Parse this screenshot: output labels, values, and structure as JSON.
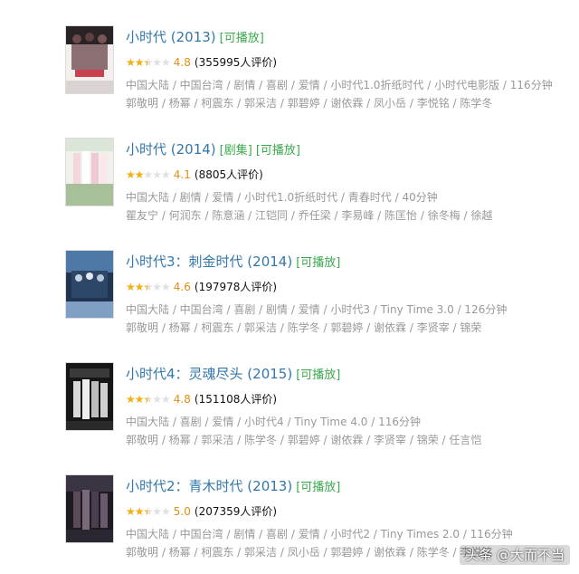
{
  "colors": {
    "title": "#3377aa",
    "tag": "#3ba94d",
    "star": "#f2b10e",
    "score": "#e09015",
    "meta": "#999999"
  },
  "results": [
    {
      "title": "小时代 (2013)",
      "tags": [
        "[可播放]"
      ],
      "rating_stars_fraction": 0.5,
      "score": "4.8",
      "votes": "(355995人评价)",
      "meta": "中国大陆 / 中国台湾 / 剧情 / 喜剧 / 爱情 / 小时代1.0折纸时代 / 小时代电影版 / 116分钟",
      "cast": "郭敬明 / 杨幂 / 柯震东 / 郭采洁 / 郭碧婷 / 谢依霖 / 凤小岳 / 李悦铭 / 陈学冬"
    },
    {
      "title": "小时代 (2014)",
      "tags": [
        "[剧集]",
        "[可播放]"
      ],
      "rating_stars_fraction": 0.4,
      "score": "4.1",
      "votes": "(8805人评价)",
      "meta": "中国大陆 / 剧情 / 爱情 / 小时代1.0折纸时代 / 青春时代 / 40分钟",
      "cast": "瞿友宁 / 何润东 / 陈意涵 / 江铠同 / 乔任梁 / 李易峰 / 陈匡怡 / 徐冬梅 / 徐越"
    },
    {
      "title": "小时代3：刺金时代 (2014)",
      "tags": [
        "[可播放]"
      ],
      "rating_stars_fraction": 0.5,
      "score": "4.6",
      "votes": "(197978人评价)",
      "meta": "中国大陆 / 中国台湾 / 喜剧 / 剧情 / 爱情 / 小时代3 / Tiny Time 3.0 / 126分钟",
      "cast": "郭敬明 / 杨幂 / 柯震东 / 郭采洁 / 陈学冬 / 郭碧婷 / 谢依霖 / 李贤宰 / 锦荣"
    },
    {
      "title": "小时代4：灵魂尽头 (2015)",
      "tags": [
        "[可播放]"
      ],
      "rating_stars_fraction": 0.5,
      "score": "4.8",
      "votes": "(151108人评价)",
      "meta": "中国大陆 / 喜剧 / 爱情 / 小时代4 / Tiny Time 4.0 / 116分钟",
      "cast": "郭敬明 / 杨幂 / 郭采洁 / 陈学冬 / 郭碧婷 / 谢依霖 / 李贤宰 / 锦荣 / 任言恺"
    },
    {
      "title": "小时代2：青木时代 (2013)",
      "tags": [
        "[可播放]"
      ],
      "rating_stars_fraction": 0.5,
      "score": "5.0",
      "votes": "(207359人评价)",
      "meta": "中国大陆 / 中国台湾 / 剧情 / 喜剧 / 爱情 / 小时代2 / Tiny Times 2.0 / 116分钟",
      "cast": "郭敬明 / 杨幂 / 柯震东 / 郭采洁 / 凤小岳 / 郭碧婷 / 谢依霖 / 陈学冬 / 李悦铭"
    }
  ],
  "watermark": "头条 @大而不当"
}
